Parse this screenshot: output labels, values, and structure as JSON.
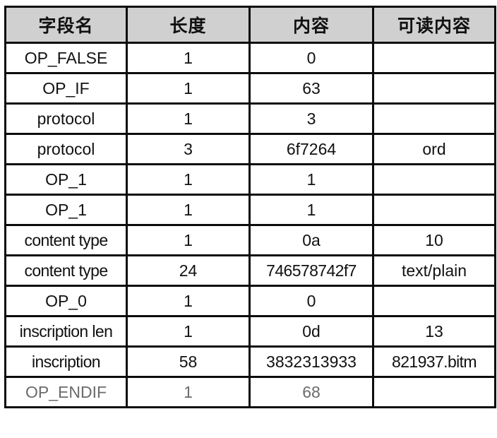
{
  "table": {
    "columns": [
      {
        "key": "name",
        "label": "字段名"
      },
      {
        "key": "len",
        "label": "长度"
      },
      {
        "key": "value",
        "label": "内容"
      },
      {
        "key": "read",
        "label": "可读内容"
      }
    ],
    "rows": [
      {
        "name": "OP_FALSE",
        "len": "1",
        "value": "0",
        "read": "",
        "muted": false
      },
      {
        "name": "OP_IF",
        "len": "1",
        "value": "63",
        "read": "",
        "muted": false
      },
      {
        "name": "protocol",
        "len": "1",
        "value": "3",
        "read": "",
        "muted": false
      },
      {
        "name": "protocol",
        "len": "3",
        "value": "6f7264",
        "read": "ord",
        "muted": false
      },
      {
        "name": "OP_1",
        "len": "1",
        "value": "1",
        "read": "",
        "muted": false
      },
      {
        "name": "OP_1",
        "len": "1",
        "value": "1",
        "read": "",
        "muted": false
      },
      {
        "name": "content type",
        "len": "1",
        "value": "0a",
        "read": "10",
        "muted": false
      },
      {
        "name": "content type",
        "len": "24",
        "value": "746578742f7",
        "read": "text/plain",
        "muted": false
      },
      {
        "name": "OP_0",
        "len": "1",
        "value": "0",
        "read": "",
        "muted": false
      },
      {
        "name": "inscription len",
        "len": "1",
        "value": "0d",
        "read": "13",
        "muted": false
      },
      {
        "name": "inscription",
        "len": "58",
        "value": "3832313933",
        "read": "821937.bitm",
        "muted": false
      },
      {
        "name": "OP_ENDIF",
        "len": "1",
        "value": "68",
        "read": "",
        "muted": true
      }
    ]
  },
  "style": {
    "header_background": "#d0d0d0",
    "border_color": "#0c0c0c",
    "text_color": "#111111",
    "muted_text_color": "#6b6b6b",
    "cell_background": "#ffffff"
  }
}
